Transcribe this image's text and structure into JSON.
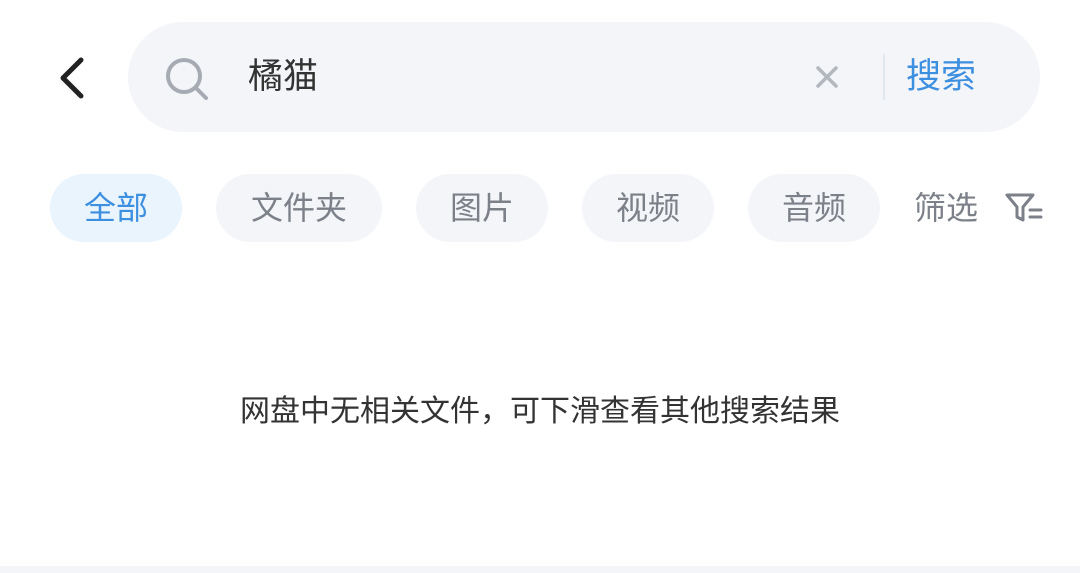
{
  "header": {
    "back_icon": "chevron-left-icon",
    "search": {
      "icon": "search-icon",
      "value": "橘猫",
      "clear_icon": "close-icon",
      "button_label": "搜索"
    }
  },
  "filters": {
    "tabs": [
      {
        "label": "全部",
        "active": true
      },
      {
        "label": "文件夹",
        "active": false
      },
      {
        "label": "图片",
        "active": false
      },
      {
        "label": "视频",
        "active": false
      },
      {
        "label": "音频",
        "active": false
      }
    ],
    "filter_label": "筛选",
    "filter_icon": "filter-icon"
  },
  "results": {
    "empty_message": "网盘中无相关文件，可下滑查看其他搜索结果"
  },
  "colors": {
    "accent": "#3d8fe0",
    "active_chip_bg": "#eaf4fd",
    "chip_bg": "#f3f5f9",
    "muted_text": "#7c8088"
  }
}
